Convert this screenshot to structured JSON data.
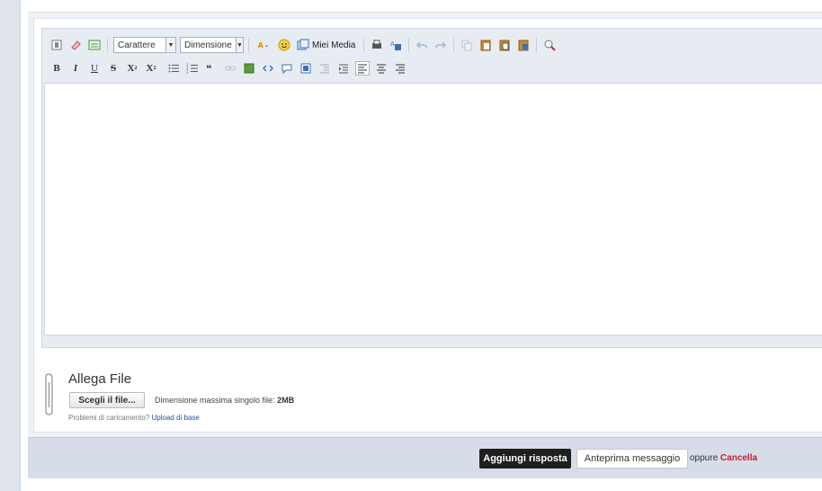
{
  "toolbar": {
    "font_select": "Carattere",
    "size_select": "Dimensione",
    "media_label": "Miei Media",
    "format": {
      "bold": "B",
      "italic": "I",
      "underline": "U",
      "strike": "S",
      "subscript": "X",
      "superscript": "X"
    }
  },
  "attach": {
    "title": "Allega File",
    "choose_label": "Scegli il file...",
    "max_size_label": "Dimensione massima singolo file: ",
    "max_size_value": "2MB",
    "problems_text": "Problemi di caricamento? ",
    "basic_upload_link": "Upload di base"
  },
  "actions": {
    "submit_label": "Aggiungi risposta",
    "preview_label": "Anteprima messaggio",
    "or_text": "oppure ",
    "cancel_label": "Cancella"
  },
  "colors": {
    "accent_dark": "#1f1f1f",
    "cancel_red": "#c0202a",
    "link_blue": "#1f4fa3"
  }
}
